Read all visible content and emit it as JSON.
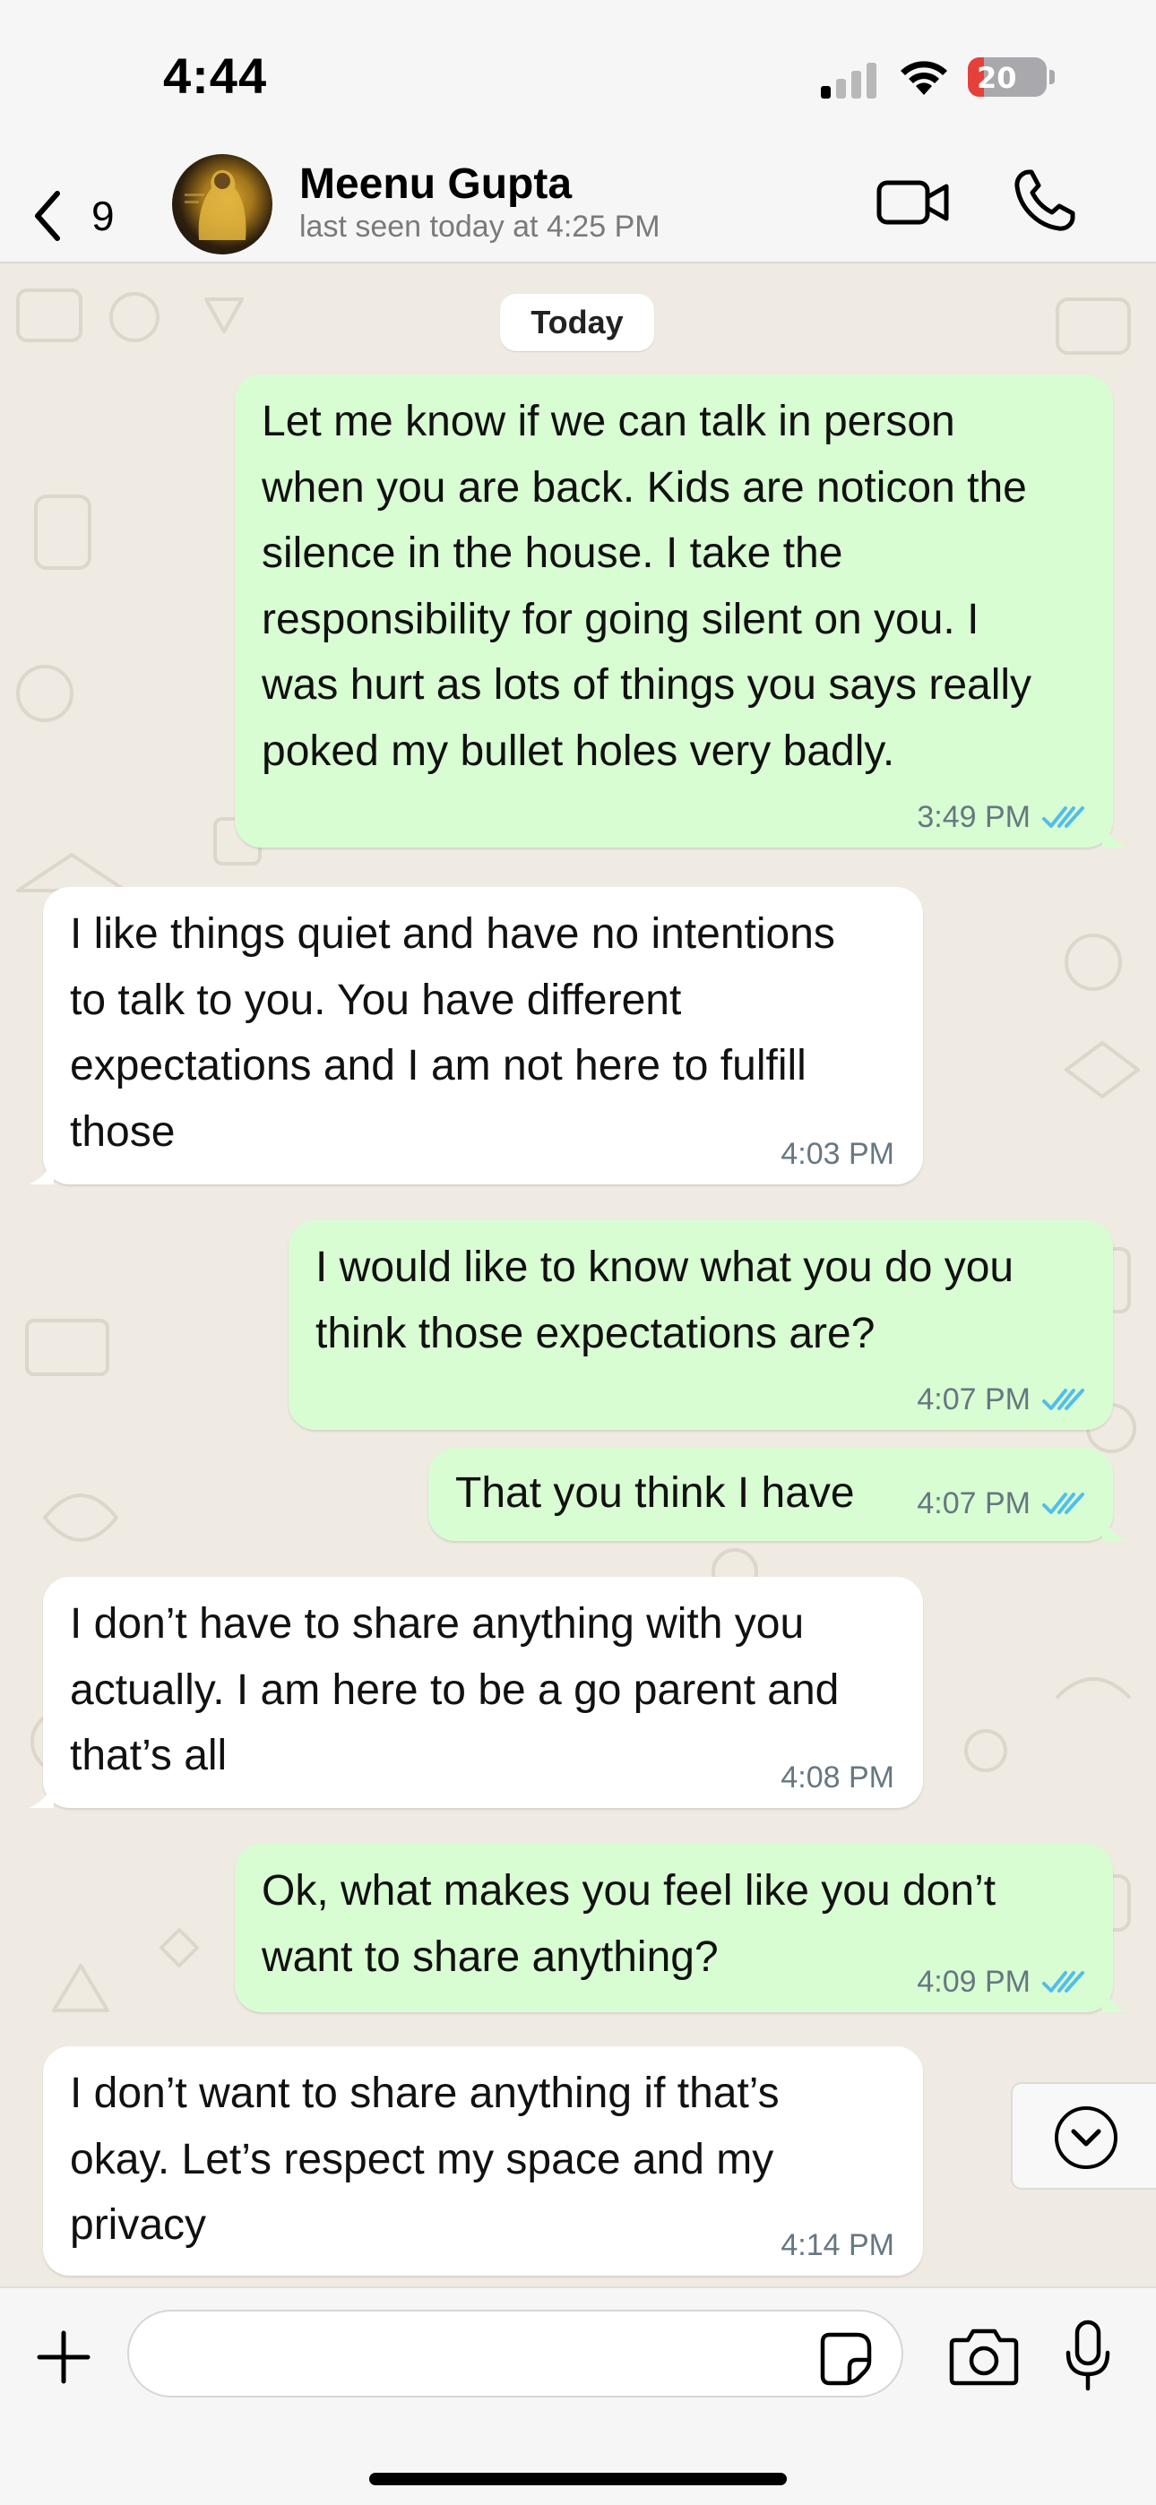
{
  "status_bar": {
    "time": "4:44",
    "battery_level": "20",
    "battery_fraction": 0.2
  },
  "header": {
    "back_count": "9",
    "contact_name": "Meenu Gupta",
    "last_seen": "last seen today at 4:25 PM"
  },
  "chat": {
    "date_separator": "Today",
    "messages": [
      {
        "direction": "outgoing",
        "text": "Let me know if we can talk in person\nwhen you are back. Kids are noticon the\nsilence in the house. I take the\nresponsibility for going silent on you. I\nwas hurt as lots of things you says really\npoked my bullet holes very badly.",
        "time": "3:49 PM",
        "status": "read"
      },
      {
        "direction": "incoming",
        "text": "I like things quiet and have no intentions\nto talk to you. You have different\nexpectations and I am not here to fulfill\nthose",
        "time": "4:03 PM"
      },
      {
        "direction": "outgoing",
        "text": "I would like to know what you do you\nthink those expectations are?",
        "time": "4:07 PM",
        "status": "read"
      },
      {
        "direction": "outgoing",
        "text": "That you think I have",
        "time": "4:07 PM",
        "status": "read"
      },
      {
        "direction": "incoming",
        "text": "I don’t have to share anything with you\nactually. I am here to be a go parent and\nthat’s all",
        "time": "4:08 PM"
      },
      {
        "direction": "outgoing",
        "text": "Ok, what makes you feel like you don’t\nwant to share anything?",
        "time": "4:09 PM",
        "status": "read"
      },
      {
        "direction": "incoming",
        "text": "I don’t want to share anything if that’s\nokay. Let’s respect my space and my\nprivacy",
        "time": "4:14 PM"
      }
    ]
  },
  "composer": {
    "value": "",
    "placeholder": ""
  },
  "colors": {
    "outgoing_bubble": "#d9fdd3",
    "incoming_bubble": "#ffffff",
    "chat_background": "#efeae2",
    "read_ticks": "#53bdeb",
    "timestamp": "#667781"
  },
  "icons": [
    "chevron-left-icon",
    "video-call-icon",
    "phone-icon",
    "double-check-icon",
    "chevron-down-circle-icon",
    "plus-icon",
    "sticker-icon",
    "camera-icon",
    "microphone-icon"
  ]
}
